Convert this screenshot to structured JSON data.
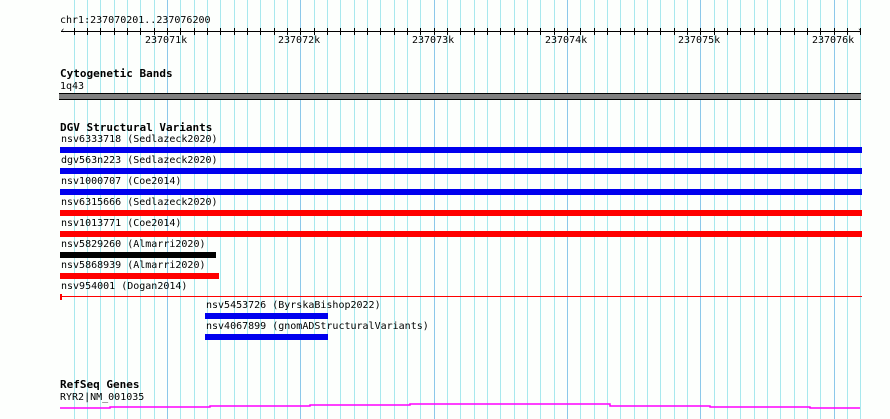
{
  "ruler": {
    "location": "chr1:237070201..237076200",
    "start": 237070201,
    "end": 237076200,
    "tick_labels": [
      "237071k",
      "237072k",
      "237073k",
      "237074k",
      "237075k",
      "237076k"
    ],
    "tick_values": [
      237071000,
      237072000,
      237073000,
      237074000,
      237075000,
      237076000
    ]
  },
  "tracks": {
    "cyto": {
      "title": "Cytogenetic Bands",
      "band": "1q43",
      "color": "#808080"
    },
    "dgv": {
      "title": "DGV Structural Variants",
      "features": [
        {
          "label": "nsv6333718 (Sedlazeck2020)",
          "start": 237070201,
          "end": 237076200,
          "color": "#0000ee"
        },
        {
          "label": "dgv563n223 (Sedlazeck2020)",
          "start": 237070201,
          "end": 237076200,
          "color": "#0000ee"
        },
        {
          "label": "nsv1000707 (Coe2014)",
          "start": 237070201,
          "end": 237076200,
          "color": "#0000ee"
        },
        {
          "label": "nsv6315666 (Sedlazeck2020)",
          "start": 237070201,
          "end": 237076200,
          "color": "#ff0000"
        },
        {
          "label": "nsv1013771 (Coe2014)",
          "start": 237070201,
          "end": 237076200,
          "color": "#ff0000"
        },
        {
          "label": "nsv5829260 (Almarri2020)",
          "start": 237070201,
          "end": 237071355,
          "color": "#000000"
        },
        {
          "label": "nsv5868939 (Almarri2020)",
          "start": 237070201,
          "end": 237071378,
          "color": "#ff0000"
        },
        {
          "label": "nsv954001 (Dogan2014)",
          "start": 237070201,
          "end": 237076200,
          "color": "#ff0000",
          "thin": true
        },
        {
          "label": "nsv5453726 (ByrskaBishop2022)",
          "start": 237071295,
          "end": 237072205,
          "color": "#0000ee"
        },
        {
          "label": "nsv4067899 (gnomADStructuralVariants)",
          "start": 237071295,
          "end": 237072205,
          "color": "#0000ee"
        }
      ]
    },
    "refseq": {
      "title": "RefSeq Genes",
      "gene": "RYR2|NM_001035",
      "color": "#ff00ff"
    }
  }
}
